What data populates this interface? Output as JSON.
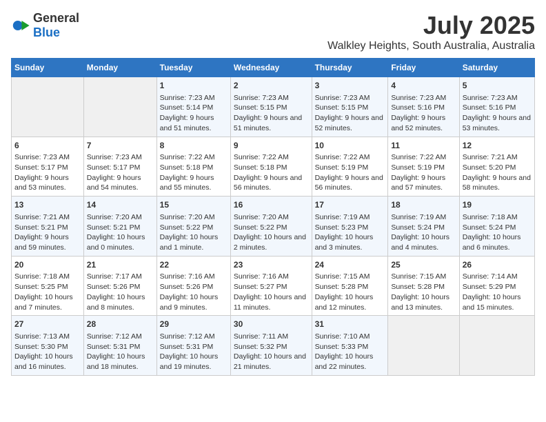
{
  "logo": {
    "general": "General",
    "blue": "Blue"
  },
  "title": "July 2025",
  "subtitle": "Walkley Heights, South Australia, Australia",
  "days_of_week": [
    "Sunday",
    "Monday",
    "Tuesday",
    "Wednesday",
    "Thursday",
    "Friday",
    "Saturday"
  ],
  "weeks": [
    [
      {
        "day": "",
        "content": ""
      },
      {
        "day": "",
        "content": ""
      },
      {
        "day": "1",
        "content": "Sunrise: 7:23 AM\nSunset: 5:14 PM\nDaylight: 9 hours and 51 minutes."
      },
      {
        "day": "2",
        "content": "Sunrise: 7:23 AM\nSunset: 5:15 PM\nDaylight: 9 hours and 51 minutes."
      },
      {
        "day": "3",
        "content": "Sunrise: 7:23 AM\nSunset: 5:15 PM\nDaylight: 9 hours and 52 minutes."
      },
      {
        "day": "4",
        "content": "Sunrise: 7:23 AM\nSunset: 5:16 PM\nDaylight: 9 hours and 52 minutes."
      },
      {
        "day": "5",
        "content": "Sunrise: 7:23 AM\nSunset: 5:16 PM\nDaylight: 9 hours and 53 minutes."
      }
    ],
    [
      {
        "day": "6",
        "content": "Sunrise: 7:23 AM\nSunset: 5:17 PM\nDaylight: 9 hours and 53 minutes."
      },
      {
        "day": "7",
        "content": "Sunrise: 7:23 AM\nSunset: 5:17 PM\nDaylight: 9 hours and 54 minutes."
      },
      {
        "day": "8",
        "content": "Sunrise: 7:22 AM\nSunset: 5:18 PM\nDaylight: 9 hours and 55 minutes."
      },
      {
        "day": "9",
        "content": "Sunrise: 7:22 AM\nSunset: 5:18 PM\nDaylight: 9 hours and 56 minutes."
      },
      {
        "day": "10",
        "content": "Sunrise: 7:22 AM\nSunset: 5:19 PM\nDaylight: 9 hours and 56 minutes."
      },
      {
        "day": "11",
        "content": "Sunrise: 7:22 AM\nSunset: 5:19 PM\nDaylight: 9 hours and 57 minutes."
      },
      {
        "day": "12",
        "content": "Sunrise: 7:21 AM\nSunset: 5:20 PM\nDaylight: 9 hours and 58 minutes."
      }
    ],
    [
      {
        "day": "13",
        "content": "Sunrise: 7:21 AM\nSunset: 5:21 PM\nDaylight: 9 hours and 59 minutes."
      },
      {
        "day": "14",
        "content": "Sunrise: 7:20 AM\nSunset: 5:21 PM\nDaylight: 10 hours and 0 minutes."
      },
      {
        "day": "15",
        "content": "Sunrise: 7:20 AM\nSunset: 5:22 PM\nDaylight: 10 hours and 1 minute."
      },
      {
        "day": "16",
        "content": "Sunrise: 7:20 AM\nSunset: 5:22 PM\nDaylight: 10 hours and 2 minutes."
      },
      {
        "day": "17",
        "content": "Sunrise: 7:19 AM\nSunset: 5:23 PM\nDaylight: 10 hours and 3 minutes."
      },
      {
        "day": "18",
        "content": "Sunrise: 7:19 AM\nSunset: 5:24 PM\nDaylight: 10 hours and 4 minutes."
      },
      {
        "day": "19",
        "content": "Sunrise: 7:18 AM\nSunset: 5:24 PM\nDaylight: 10 hours and 6 minutes."
      }
    ],
    [
      {
        "day": "20",
        "content": "Sunrise: 7:18 AM\nSunset: 5:25 PM\nDaylight: 10 hours and 7 minutes."
      },
      {
        "day": "21",
        "content": "Sunrise: 7:17 AM\nSunset: 5:26 PM\nDaylight: 10 hours and 8 minutes."
      },
      {
        "day": "22",
        "content": "Sunrise: 7:16 AM\nSunset: 5:26 PM\nDaylight: 10 hours and 9 minutes."
      },
      {
        "day": "23",
        "content": "Sunrise: 7:16 AM\nSunset: 5:27 PM\nDaylight: 10 hours and 11 minutes."
      },
      {
        "day": "24",
        "content": "Sunrise: 7:15 AM\nSunset: 5:28 PM\nDaylight: 10 hours and 12 minutes."
      },
      {
        "day": "25",
        "content": "Sunrise: 7:15 AM\nSunset: 5:28 PM\nDaylight: 10 hours and 13 minutes."
      },
      {
        "day": "26",
        "content": "Sunrise: 7:14 AM\nSunset: 5:29 PM\nDaylight: 10 hours and 15 minutes."
      }
    ],
    [
      {
        "day": "27",
        "content": "Sunrise: 7:13 AM\nSunset: 5:30 PM\nDaylight: 10 hours and 16 minutes."
      },
      {
        "day": "28",
        "content": "Sunrise: 7:12 AM\nSunset: 5:31 PM\nDaylight: 10 hours and 18 minutes."
      },
      {
        "day": "29",
        "content": "Sunrise: 7:12 AM\nSunset: 5:31 PM\nDaylight: 10 hours and 19 minutes."
      },
      {
        "day": "30",
        "content": "Sunrise: 7:11 AM\nSunset: 5:32 PM\nDaylight: 10 hours and 21 minutes."
      },
      {
        "day": "31",
        "content": "Sunrise: 7:10 AM\nSunset: 5:33 PM\nDaylight: 10 hours and 22 minutes."
      },
      {
        "day": "",
        "content": ""
      },
      {
        "day": "",
        "content": ""
      }
    ]
  ]
}
